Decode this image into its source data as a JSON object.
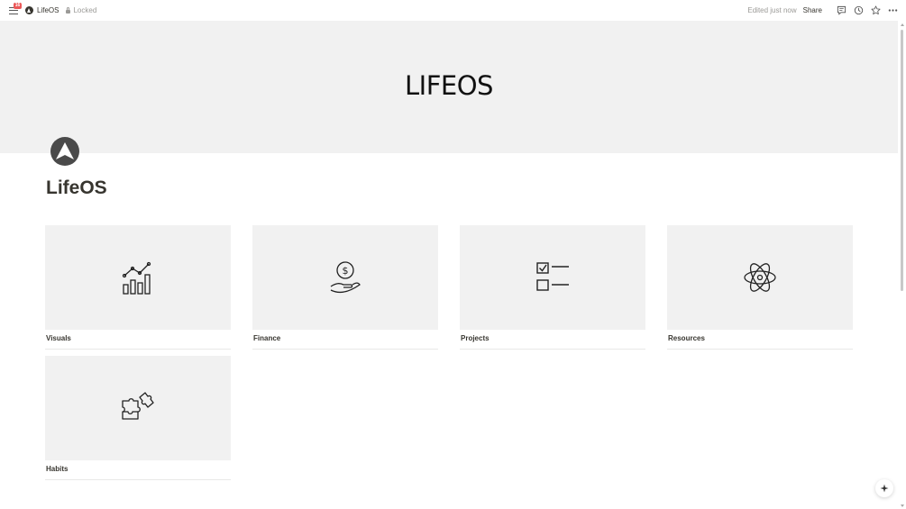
{
  "topbar": {
    "notification_count": "16",
    "breadcrumb_title": "LifeOS",
    "locked_label": "Locked",
    "edited_label": "Edited just now",
    "share_label": "Share"
  },
  "cover": {
    "title": "LIFEOS"
  },
  "page": {
    "title": "LifeOS",
    "icon": "lifeos-logo-icon"
  },
  "gallery": {
    "cards": [
      {
        "label": "Visuals",
        "icon": "chart-growth-icon"
      },
      {
        "label": "Finance",
        "icon": "money-hand-icon"
      },
      {
        "label": "Projects",
        "icon": "checklist-icon"
      },
      {
        "label": "Resources",
        "icon": "atom-icon"
      },
      {
        "label": "Habits",
        "icon": "puzzle-icon"
      }
    ]
  },
  "colors": {
    "cover_bg": "#f1f1f1",
    "text": "#37352f",
    "muted": "#9b9a97",
    "badge": "#eb5757"
  }
}
